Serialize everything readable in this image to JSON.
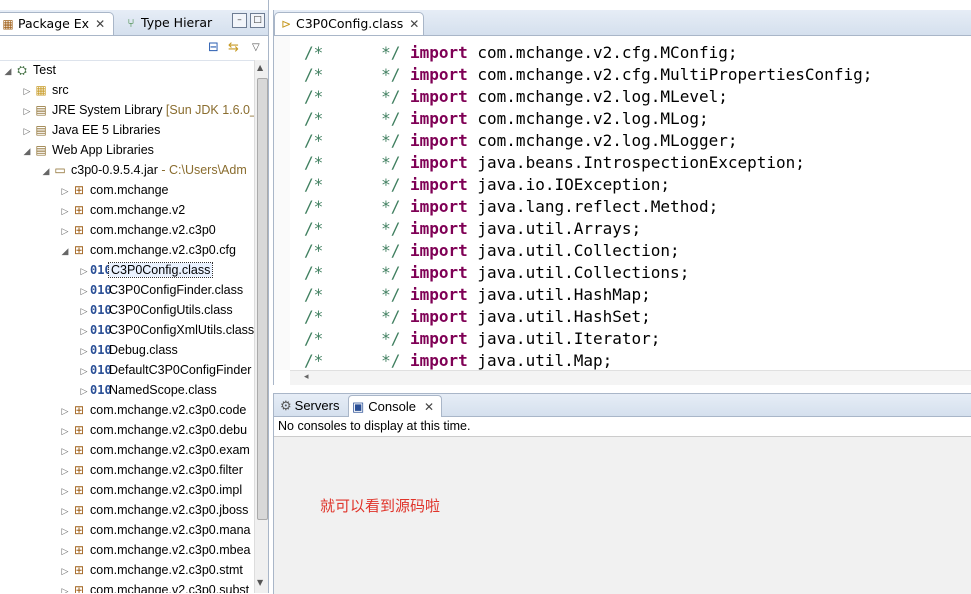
{
  "package_explorer": {
    "tabs": [
      {
        "label": "Package Ex",
        "icon": "package-explorer-icon",
        "active": true
      },
      {
        "label": "Type Hierar",
        "icon": "type-hierarchy-icon",
        "active": false
      }
    ],
    "toolbar": [
      {
        "icon": "collapse-all-icon"
      },
      {
        "icon": "link-with-editor-icon"
      },
      {
        "icon": "view-menu-icon"
      }
    ],
    "tree": [
      {
        "label": "Test",
        "decoration": "",
        "icon": "project-icon",
        "glyph": "⛭",
        "level": 0,
        "expander": "expanded"
      },
      {
        "label": "src",
        "decoration": "",
        "icon": "source-folder-icon",
        "glyph": "▦",
        "level": 1,
        "expander": "collapsed"
      },
      {
        "label": "JRE System Library",
        "decoration": " [Sun JDK 1.6.0_",
        "icon": "library-icon",
        "glyph": "▤",
        "level": 1,
        "expander": "collapsed"
      },
      {
        "label": "Java EE 5 Libraries",
        "decoration": "",
        "icon": "library-icon",
        "glyph": "▤",
        "level": 1,
        "expander": "collapsed"
      },
      {
        "label": "Web App Libraries",
        "decoration": "",
        "icon": "library-icon",
        "glyph": "▤",
        "level": 1,
        "expander": "expanded"
      },
      {
        "label": "c3p0-0.9.5.4.jar",
        "decoration": " - C:\\Users\\Adm",
        "icon": "jar-icon",
        "glyph": "▭",
        "level": 2,
        "expander": "expanded"
      },
      {
        "label": "com.mchange",
        "decoration": "",
        "icon": "package-icon",
        "glyph": "⊞",
        "level": 3,
        "expander": "collapsed"
      },
      {
        "label": "com.mchange.v2",
        "decoration": "",
        "icon": "package-icon",
        "glyph": "⊞",
        "level": 3,
        "expander": "collapsed"
      },
      {
        "label": "com.mchange.v2.c3p0",
        "decoration": "",
        "icon": "package-icon",
        "glyph": "⊞",
        "level": 3,
        "expander": "collapsed"
      },
      {
        "label": "com.mchange.v2.c3p0.cfg",
        "decoration": "",
        "icon": "package-icon",
        "glyph": "⊞",
        "level": 3,
        "expander": "expanded"
      },
      {
        "label": "C3P0Config.class",
        "decoration": "",
        "icon": "class-file-icon",
        "glyph": "010",
        "level": 4,
        "expander": "collapsed",
        "selected": true
      },
      {
        "label": "C3P0ConfigFinder.class",
        "decoration": "",
        "icon": "class-file-icon",
        "glyph": "010",
        "level": 4,
        "expander": "collapsed"
      },
      {
        "label": "C3P0ConfigUtils.class",
        "decoration": "",
        "icon": "class-file-icon",
        "glyph": "010",
        "level": 4,
        "expander": "collapsed"
      },
      {
        "label": "C3P0ConfigXmlUtils.class",
        "decoration": "",
        "icon": "class-file-icon",
        "glyph": "010",
        "level": 4,
        "expander": "collapsed"
      },
      {
        "label": "Debug.class",
        "decoration": "",
        "icon": "class-file-icon",
        "glyph": "010",
        "level": 4,
        "expander": "collapsed"
      },
      {
        "label": "DefaultC3P0ConfigFinder",
        "decoration": "",
        "icon": "class-file-icon",
        "glyph": "010",
        "level": 4,
        "expander": "collapsed"
      },
      {
        "label": "NamedScope.class",
        "decoration": "",
        "icon": "class-file-icon",
        "glyph": "010",
        "level": 4,
        "expander": "collapsed"
      },
      {
        "label": "com.mchange.v2.c3p0.code",
        "decoration": "",
        "icon": "package-icon",
        "glyph": "⊞",
        "level": 3,
        "expander": "collapsed"
      },
      {
        "label": "com.mchange.v2.c3p0.debu",
        "decoration": "",
        "icon": "package-icon",
        "glyph": "⊞",
        "level": 3,
        "expander": "collapsed"
      },
      {
        "label": "com.mchange.v2.c3p0.exam",
        "decoration": "",
        "icon": "package-icon",
        "glyph": "⊞",
        "level": 3,
        "expander": "collapsed"
      },
      {
        "label": "com.mchange.v2.c3p0.filter",
        "decoration": "",
        "icon": "package-icon",
        "glyph": "⊞",
        "level": 3,
        "expander": "collapsed"
      },
      {
        "label": "com.mchange.v2.c3p0.impl",
        "decoration": "",
        "icon": "package-icon",
        "glyph": "⊞",
        "level": 3,
        "expander": "collapsed"
      },
      {
        "label": "com.mchange.v2.c3p0.jboss",
        "decoration": "",
        "icon": "package-icon",
        "glyph": "⊞",
        "level": 3,
        "expander": "collapsed"
      },
      {
        "label": "com.mchange.v2.c3p0.mana",
        "decoration": "",
        "icon": "package-icon",
        "glyph": "⊞",
        "level": 3,
        "expander": "collapsed"
      },
      {
        "label": "com.mchange.v2.c3p0.mbea",
        "decoration": "",
        "icon": "package-icon",
        "glyph": "⊞",
        "level": 3,
        "expander": "collapsed"
      },
      {
        "label": "com.mchange.v2.c3p0.stmt",
        "decoration": "",
        "icon": "package-icon",
        "glyph": "⊞",
        "level": 3,
        "expander": "collapsed"
      },
      {
        "label": "com.mchange.v2.c3p0.subst",
        "decoration": "",
        "icon": "package-icon",
        "glyph": "⊞",
        "level": 3,
        "expander": "collapsed"
      }
    ]
  },
  "editor": {
    "tab": {
      "label": "C3P0Config.class",
      "icon": "class-file-icon"
    },
    "lines": [
      {
        "comment": "/*      */ ",
        "keyword": "import",
        "rest": " com.mchange.v2.cfg.MConfig;"
      },
      {
        "comment": "/*      */ ",
        "keyword": "import",
        "rest": " com.mchange.v2.cfg.MultiPropertiesConfig;"
      },
      {
        "comment": "/*      */ ",
        "keyword": "import",
        "rest": " com.mchange.v2.log.MLevel;"
      },
      {
        "comment": "/*      */ ",
        "keyword": "import",
        "rest": " com.mchange.v2.log.MLog;"
      },
      {
        "comment": "/*      */ ",
        "keyword": "import",
        "rest": " com.mchange.v2.log.MLogger;"
      },
      {
        "comment": "/*      */ ",
        "keyword": "import",
        "rest": " java.beans.IntrospectionException;"
      },
      {
        "comment": "/*      */ ",
        "keyword": "import",
        "rest": " java.io.IOException;"
      },
      {
        "comment": "/*      */ ",
        "keyword": "import",
        "rest": " java.lang.reflect.Method;"
      },
      {
        "comment": "/*      */ ",
        "keyword": "import",
        "rest": " java.util.Arrays;"
      },
      {
        "comment": "/*      */ ",
        "keyword": "import",
        "rest": " java.util.Collection;"
      },
      {
        "comment": "/*      */ ",
        "keyword": "import",
        "rest": " java.util.Collections;"
      },
      {
        "comment": "/*      */ ",
        "keyword": "import",
        "rest": " java.util.HashMap;"
      },
      {
        "comment": "/*      */ ",
        "keyword": "import",
        "rest": " java.util.HashSet;"
      },
      {
        "comment": "/*      */ ",
        "keyword": "import",
        "rest": " java.util.Iterator;"
      },
      {
        "comment": "/*      */ ",
        "keyword": "import",
        "rest": " java.util.Map;"
      }
    ]
  },
  "console": {
    "tabs": [
      {
        "label": "Servers",
        "icon": "servers-icon",
        "active": false
      },
      {
        "label": "Console",
        "icon": "console-icon",
        "active": true
      }
    ],
    "message": "No consoles to display at this time.",
    "annotation": "就可以看到源码啦"
  },
  "colors": {
    "keyword": "#7f0055",
    "comment": "#3f7f5f",
    "annotation": "#e0342a"
  }
}
